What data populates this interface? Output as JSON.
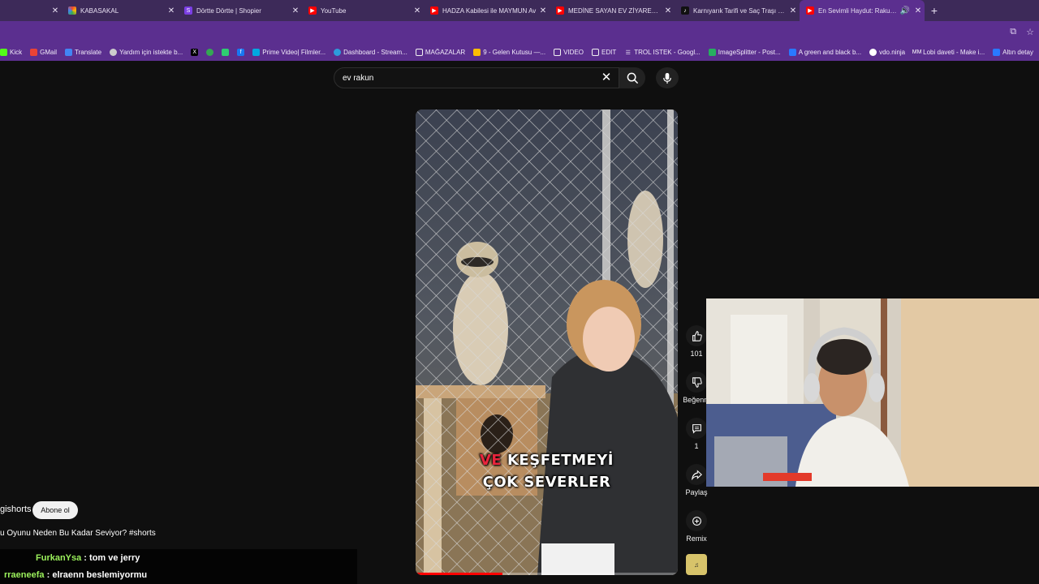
{
  "tabs": [
    {
      "title": "KABASAKAL",
      "favicon_color": "#4caf50",
      "favicon_icon": "multicolor-icon",
      "active": false
    },
    {
      "title": "Dörtte Dörtte | Shopier",
      "favicon_color": "#7b3fe4",
      "favicon_icon": "shopier-icon",
      "active": false
    },
    {
      "title": "YouTube",
      "favicon_color": "#ff0000",
      "favicon_icon": "youtube-icon",
      "active": false
    },
    {
      "title": "HADZA Kabilesi ile MAYMUN Av",
      "favicon_color": "#ff0000",
      "favicon_icon": "youtube-icon",
      "active": false
    },
    {
      "title": "MEDİNE SAYAN EV ZİYARETİ - Y",
      "favicon_color": "#ff0000",
      "favicon_icon": "youtube-icon",
      "active": false
    },
    {
      "title": "Karnıyarık Tarifi ve Saç Traşı Mu",
      "favicon_color": "#111111",
      "favicon_icon": "tiktok-icon",
      "active": false
    },
    {
      "title": "En Sevimli Haydut: Rakun! #",
      "favicon_color": "#ff0000",
      "favicon_icon": "youtube-icon",
      "active": true
    }
  ],
  "bookmarks": [
    {
      "label": "Kick",
      "icon_color": "#53fc18"
    },
    {
      "label": "GMail",
      "icon_color": "#ea4335"
    },
    {
      "label": "Translate",
      "icon_color": "#4285f4"
    },
    {
      "label": "Yardım için istekte b...",
      "icon_color": "#cccccc"
    },
    {
      "label": "",
      "icon_color": "#000000",
      "icon": "x-icon"
    },
    {
      "label": "",
      "icon_color": "#34a853",
      "icon": "drive-icon"
    },
    {
      "label": "",
      "icon_color": "#2ecc71",
      "icon": "evernote-icon"
    },
    {
      "label": "",
      "icon_color": "#1877f2",
      "icon": "facebook-icon"
    },
    {
      "label": "Prime Video| Filmler...",
      "icon_color": "#00a8e1"
    },
    {
      "label": "Dashboard - Stream...",
      "icon_color": "#2d9cdb"
    },
    {
      "label": "MAĞAZALAR",
      "icon_color": "#f1f1f1",
      "icon": "folder-icon"
    },
    {
      "label": "9 - Gelen Kutusu —...",
      "icon_color": "#fbbc04"
    },
    {
      "label": "VIDEO",
      "icon_color": "#f1f1f1",
      "icon": "folder-icon"
    },
    {
      "label": "EDIT",
      "icon_color": "#f1f1f1",
      "icon": "folder-icon"
    },
    {
      "label": "TROL ISTEK - Googl...",
      "icon_color": "#f1f1f1"
    },
    {
      "label": "ImageSplitter - Post...",
      "icon_color": "#27ae60"
    },
    {
      "label": "A green and black b...",
      "icon_color": "#2979ff"
    },
    {
      "label": "vdo.ninja",
      "icon_color": "#ffffff"
    },
    {
      "label": "Lobi daveti - Make i...",
      "icon_color": "#ffffff"
    },
    {
      "label": "Altın detay",
      "icon_color": "#2979ff"
    }
  ],
  "search": {
    "query": "ev rakun"
  },
  "video": {
    "caption_word1": "VE",
    "caption_word2": "KEŞFETMEYİ",
    "caption_line2": "ÇOK SEVERLER",
    "progress_fraction": 0.33,
    "progress_color": "#ff0000",
    "highlight_color": "#e8243c"
  },
  "actions": {
    "like_count": "101",
    "dislike_label": "Beğenm",
    "comments_count": "1",
    "share_label": "Paylaş",
    "remix_label": "Remix"
  },
  "channel": {
    "name": "gishorts",
    "subscribe_label": "Abone ol",
    "title": "u Oyunu Neden Bu Kadar Seviyor? #shorts"
  },
  "chat": [
    {
      "user": "FurkanYsa",
      "separator": " : ",
      "message": "tom ve jerry"
    },
    {
      "user": "rraeneefa",
      "separator": " : ",
      "message": "elraenn beslemiyormu"
    }
  ]
}
